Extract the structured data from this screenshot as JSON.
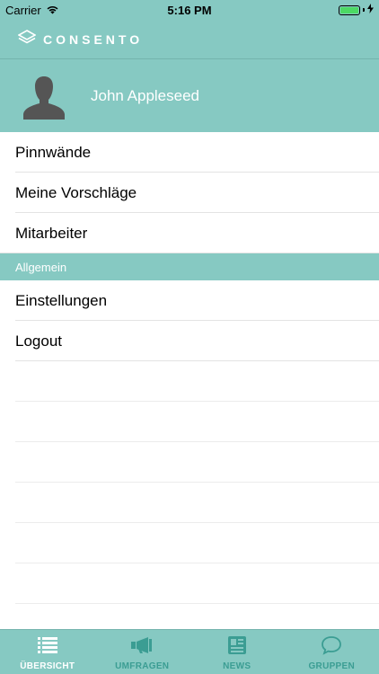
{
  "status_bar": {
    "carrier": "Carrier",
    "time": "5:16 PM",
    "icons": [
      "wifi-icon",
      "battery-icon",
      "charging-bolt-icon"
    ]
  },
  "header": {
    "logo_text": "CONSENTO",
    "logo_icon": "consento-logo-icon"
  },
  "profile": {
    "name": "John Appleseed",
    "avatar_icon": "person-silhouette-icon"
  },
  "menu": {
    "items": [
      {
        "label": "Pinnwände"
      },
      {
        "label": "Meine Vorschläge"
      },
      {
        "label": "Mitarbeiter"
      }
    ],
    "section_header": "Allgemein",
    "general_items": [
      {
        "label": "Einstellungen"
      },
      {
        "label": "Logout"
      }
    ]
  },
  "tab_bar": {
    "tabs": [
      {
        "label": "ÜBERSICHT",
        "icon": "list-icon",
        "active": true
      },
      {
        "label": "UMFRAGEN",
        "icon": "megaphone-icon",
        "active": false
      },
      {
        "label": "NEWS",
        "icon": "newspaper-icon",
        "active": false
      },
      {
        "label": "GRUPPEN",
        "icon": "speech-bubble-icon",
        "active": false
      }
    ]
  },
  "colors": {
    "primary_teal": "#86c9c2",
    "inactive_tab": "#3b9d93",
    "battery_green": "#4cd964"
  }
}
